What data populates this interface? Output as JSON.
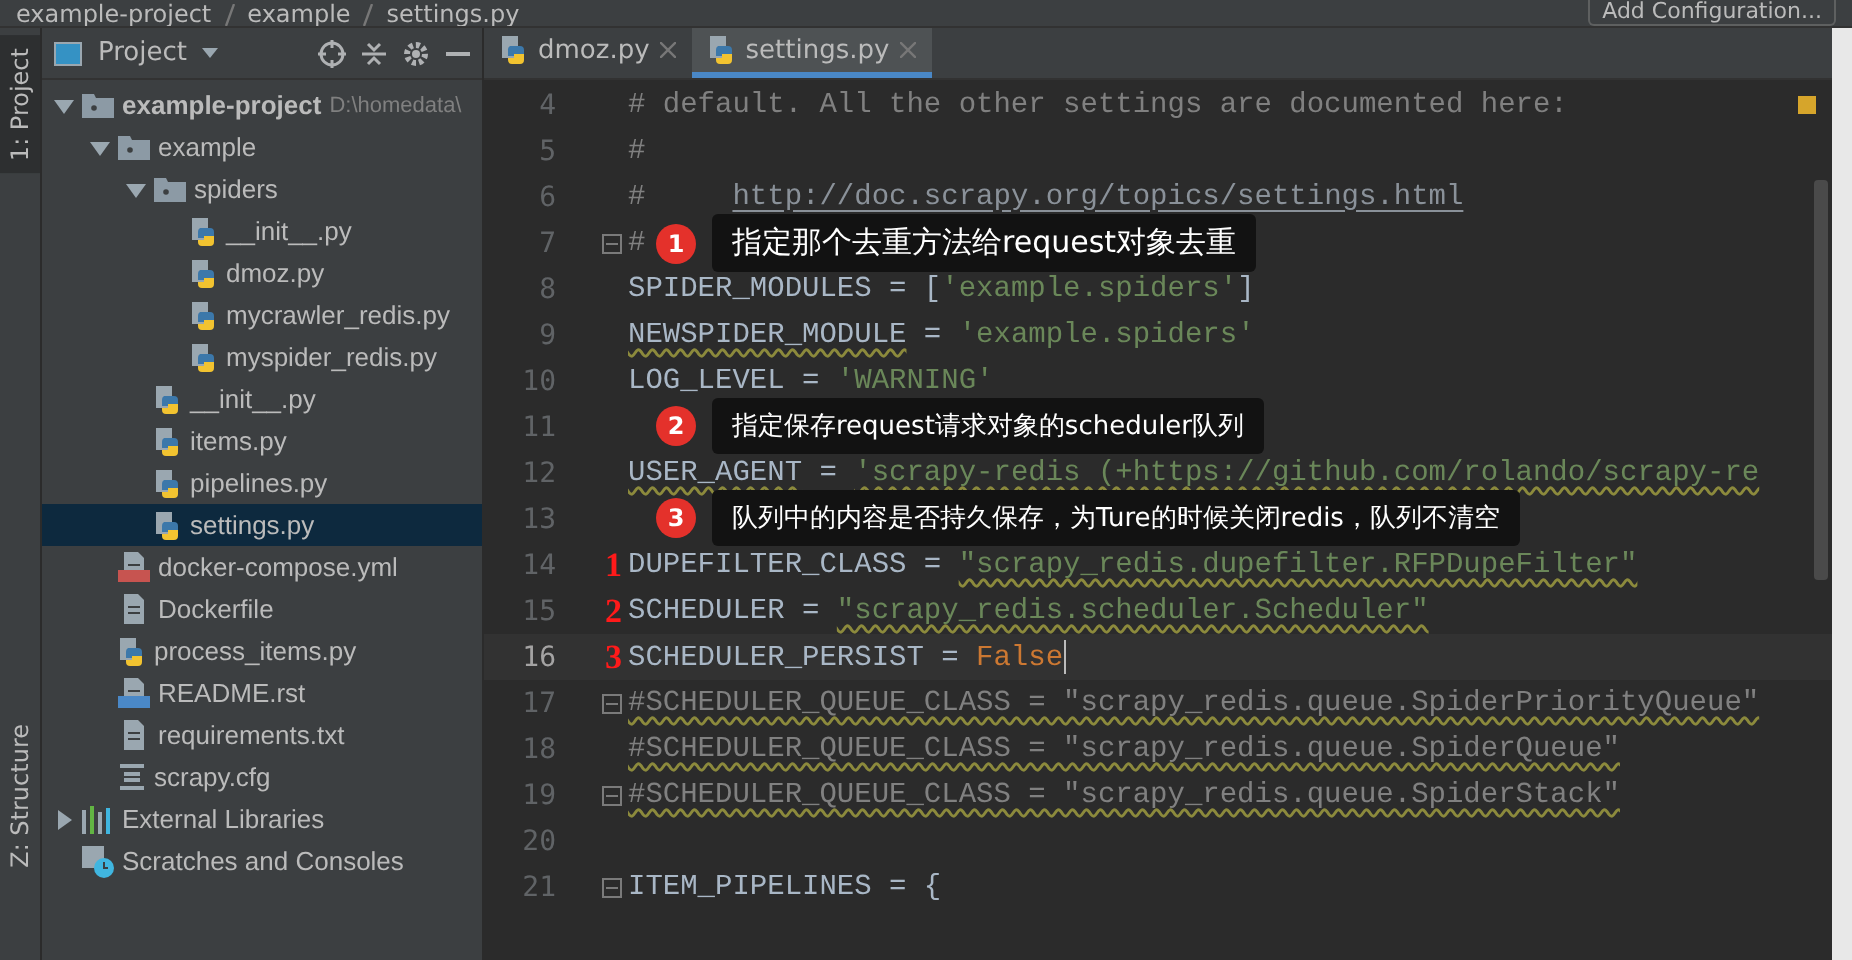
{
  "breadcrumb": [
    "example-project",
    "example",
    "settings.py"
  ],
  "run_config": {
    "label": "Add Configuration..."
  },
  "tool_strip": [
    {
      "label": "1: Project",
      "selected": true
    },
    {
      "label": "Z: Structure",
      "selected": false
    }
  ],
  "project_panel": {
    "title": "Project",
    "tree": [
      {
        "label": "example-project",
        "note": "D:\\homedata\\",
        "kind": "root",
        "expanded": true,
        "selected": false,
        "children": [
          {
            "label": "example",
            "kind": "package",
            "expanded": true,
            "selected": false,
            "children": [
              {
                "label": "spiders",
                "kind": "package",
                "expanded": true,
                "selected": false,
                "children": [
                  {
                    "label": "__init__.py",
                    "kind": "python",
                    "selected": false
                  },
                  {
                    "label": "dmoz.py",
                    "kind": "python",
                    "selected": false
                  },
                  {
                    "label": "mycrawler_redis.py",
                    "kind": "python",
                    "selected": false
                  },
                  {
                    "label": "myspider_redis.py",
                    "kind": "python",
                    "selected": false
                  }
                ]
              },
              {
                "label": "__init__.py",
                "kind": "python",
                "selected": false
              },
              {
                "label": "items.py",
                "kind": "python",
                "selected": false
              },
              {
                "label": "pipelines.py",
                "kind": "python",
                "selected": false
              },
              {
                "label": "settings.py",
                "kind": "python",
                "selected": true
              }
            ]
          },
          {
            "label": "docker-compose.yml",
            "kind": "yml",
            "selected": false
          },
          {
            "label": "Dockerfile",
            "kind": "text",
            "selected": false
          },
          {
            "label": "process_items.py",
            "kind": "python",
            "selected": false
          },
          {
            "label": "README.rst",
            "kind": "rst",
            "selected": false
          },
          {
            "label": "requirements.txt",
            "kind": "text",
            "selected": false
          },
          {
            "label": "scrapy.cfg",
            "kind": "cfg",
            "selected": false
          }
        ]
      },
      {
        "label": "External Libraries",
        "kind": "library",
        "expanded": false,
        "selected": false
      },
      {
        "label": "Scratches and Consoles",
        "kind": "scratches",
        "selected": false
      }
    ]
  },
  "editor_tabs": [
    {
      "label": "dmoz.py",
      "selected": false
    },
    {
      "label": "settings.py",
      "selected": true
    }
  ],
  "code_lines": [
    {
      "number": "4",
      "current": false,
      "tokens": [
        {
          "kind": "comment",
          "text": "# default. All the other settings are documented here:"
        }
      ]
    },
    {
      "number": "5",
      "current": false,
      "tokens": [
        {
          "kind": "comment",
          "text": "#"
        }
      ]
    },
    {
      "number": "6",
      "current": false,
      "tokens": [
        {
          "kind": "comment",
          "text": "#     "
        },
        {
          "kind": "link",
          "text": "http://doc.scrapy.org/topics/settings.html"
        }
      ]
    },
    {
      "number": "7",
      "current": false,
      "fold": true,
      "tokens": [
        {
          "kind": "comment",
          "text": "#"
        }
      ],
      "callout": {
        "badge": "1",
        "text": "指定那个去重方法给request对象去重"
      }
    },
    {
      "number": "8",
      "current": false,
      "tokens": [
        {
          "kind": "ident",
          "text": "SPIDER_MODULES = ["
        },
        {
          "kind": "string",
          "text": "'example.spiders'"
        },
        {
          "kind": "ident",
          "text": "]"
        }
      ]
    },
    {
      "number": "9",
      "current": false,
      "tokens": [
        {
          "kind": "ident",
          "text": "NEWSPIDER_MODULE",
          "warned": true
        },
        {
          "kind": "ident",
          "text": " = "
        },
        {
          "kind": "string",
          "text": "'example.spiders'"
        }
      ]
    },
    {
      "number": "10",
      "current": false,
      "tokens": [
        {
          "kind": "ident",
          "text": "LOG_LEVEL = "
        },
        {
          "kind": "string",
          "text": "'WARNING'"
        }
      ]
    },
    {
      "number": "11",
      "current": false,
      "callout": {
        "badge": "2",
        "text": "指定保存request请求对象的scheduler队列"
      }
    },
    {
      "number": "12",
      "current": false,
      "tokens": [
        {
          "kind": "ident",
          "text": "USER_AGENT",
          "warned": true
        },
        {
          "kind": "ident",
          "text": " = "
        },
        {
          "kind": "string",
          "text": "'scrapy-redis (+https://github.com/rolando/scrapy-re",
          "warned": true
        }
      ]
    },
    {
      "number": "13",
      "current": false,
      "callout": {
        "badge": "3",
        "text": "队列中的内容是否持久保存，为Ture的时候关闭redis，队列不清空"
      }
    },
    {
      "number": "14",
      "current": false,
      "mark": "1",
      "tokens": [
        {
          "kind": "ident",
          "text": "DUPEFILTER_CLASS = "
        },
        {
          "kind": "string",
          "text": "\"scrapy_redis.dupefilter.RFPDupeFilter\"",
          "warned": true
        }
      ]
    },
    {
      "number": "15",
      "current": false,
      "mark": "2",
      "tokens": [
        {
          "kind": "ident",
          "text": "SCHEDULER = "
        },
        {
          "kind": "string",
          "text": "\"scrapy_redis.scheduler.Scheduler\"",
          "warned": true
        }
      ]
    },
    {
      "number": "16",
      "current": true,
      "mark": "3",
      "tokens": [
        {
          "kind": "ident",
          "text": "SCHEDULER_PERSIST = "
        },
        {
          "kind": "keyword",
          "text": "False"
        }
      ]
    },
    {
      "number": "17",
      "current": false,
      "fold": true,
      "tokens": [
        {
          "kind": "comment",
          "text": "#SCHEDULER_QUEUE_CLASS = \"scrapy_redis.queue.SpiderPriorityQueue\"",
          "warned": true
        }
      ]
    },
    {
      "number": "18",
      "current": false,
      "tokens": [
        {
          "kind": "comment",
          "text": "#SCHEDULER_QUEUE_CLASS = \"scrapy_redis.queue.SpiderQueue\"",
          "warned": true
        }
      ]
    },
    {
      "number": "19",
      "current": false,
      "fold": true,
      "tokens": [
        {
          "kind": "comment",
          "text": "#SCHEDULER_QUEUE_CLASS = \"scrapy_redis.queue.SpiderStack\"",
          "warned": true
        }
      ]
    },
    {
      "number": "20",
      "current": false
    },
    {
      "number": "21",
      "current": false,
      "fold": true,
      "tokens": [
        {
          "kind": "ident",
          "text": "ITEM_PIPELINES = {"
        }
      ]
    }
  ]
}
